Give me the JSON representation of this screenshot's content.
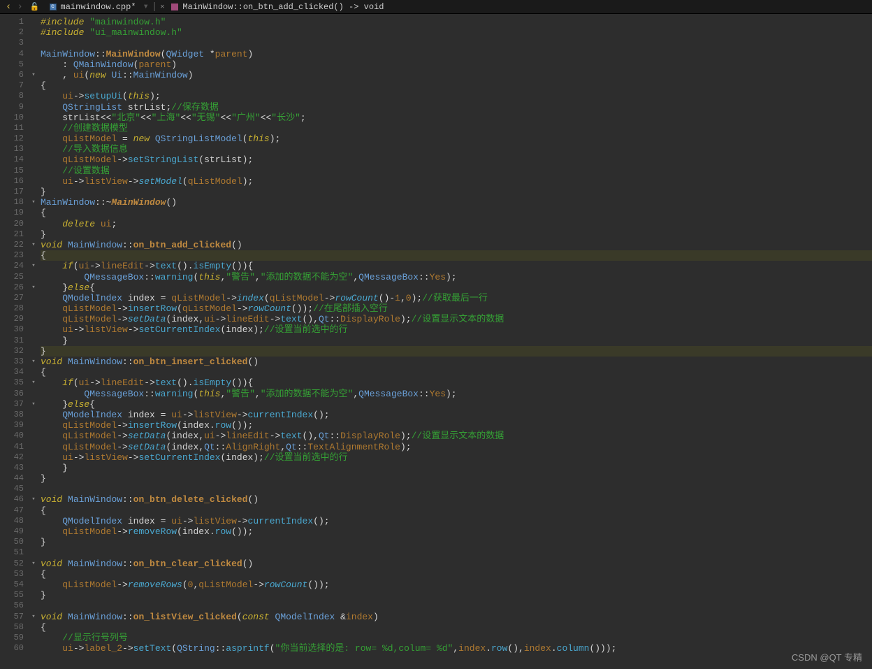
{
  "toolbar": {
    "tab_filename": "mainwindow.cpp*",
    "breadcrumb": "MainWindow::on_btn_add_clicked() -> void"
  },
  "watermark": "CSDN @QT 专精",
  "fold_markers": {
    "6": "▾",
    "18": "▾",
    "22": "▾",
    "24": "▾",
    "26": "▾",
    "33": "▾",
    "35": "▾",
    "37": "▾",
    "46": "▾",
    "52": "▾",
    "57": "▾"
  },
  "code_lines": [
    {
      "n": 1,
      "html": "<span class='kw'>#include</span> <span class='str'>\"mainwindow.h\"</span>"
    },
    {
      "n": 2,
      "html": "<span class='kw'>#include</span> <span class='str'>\"ui_mainwindow.h\"</span>"
    },
    {
      "n": 3,
      "html": ""
    },
    {
      "n": 4,
      "html": "<span class='cls'>MainWindow</span>::<span class='memb'>MainWindow</span>(<span class='typ'>QWidget</span> *<span class='mem'>parent</span>)"
    },
    {
      "n": 5,
      "html": "    : <span class='typ'>QMainWindow</span>(<span class='mem'>parent</span>)"
    },
    {
      "n": 6,
      "html": "    , <span class='mem'>ui</span>(<span class='kw'>new</span> <span class='ns'>Ui</span>::<span class='typ'>MainWindow</span>)"
    },
    {
      "n": 7,
      "html": "{"
    },
    {
      "n": 8,
      "html": "    <span class='mem'>ui</span>-&gt;<span class='fn'>setupUi</span>(<span class='kw'>this</span>);"
    },
    {
      "n": 9,
      "html": "    <span class='typ'>QStringList</span> strList;<span class='cmt'>//保存数据</span>"
    },
    {
      "n": 10,
      "html": "    strList&lt;&lt;<span class='str'>\"北京\"</span>&lt;&lt;<span class='str'>\"上海\"</span>&lt;&lt;<span class='str'>\"无锡\"</span>&lt;&lt;<span class='str'>\"广州\"</span>&lt;&lt;<span class='str'>\"长沙\"</span>;"
    },
    {
      "n": 11,
      "html": "    <span class='cmt'>//创建数据模型</span>"
    },
    {
      "n": 12,
      "html": "    <span class='mem'>qListModel</span> = <span class='kw'>new</span> <span class='typ'>QStringListModel</span>(<span class='kw'>this</span>);"
    },
    {
      "n": 13,
      "html": "    <span class='cmt'>//导入数据信息</span>"
    },
    {
      "n": 14,
      "html": "    <span class='mem'>qListModel</span>-&gt;<span class='fn'>setStringList</span>(strList);"
    },
    {
      "n": 15,
      "html": "    <span class='cmt'>//设置数据</span>"
    },
    {
      "n": 16,
      "html": "    <span class='mem'>ui</span>-&gt;<span class='mem'>listView</span>-&gt;<span class='fni'>setModel</span>(<span class='mem'>qListModel</span>);"
    },
    {
      "n": 17,
      "html": "}"
    },
    {
      "n": 18,
      "html": "<span class='cls'>MainWindow</span>::~<span class='memb emph'>MainWindow</span>()"
    },
    {
      "n": 19,
      "html": "{"
    },
    {
      "n": 20,
      "html": "    <span class='kw'>delete</span> <span class='mem'>ui</span>;"
    },
    {
      "n": 21,
      "html": "}"
    },
    {
      "n": 22,
      "html": "<span class='kw'>void</span> <span class='cls'>MainWindow</span>::<span class='memb'>on_btn_add_clicked</span>()"
    },
    {
      "n": 23,
      "html": "<span class='hl-line'>{</span>"
    },
    {
      "n": 24,
      "html": "    <span class='kw'>if</span>(<span class='mem'>ui</span>-&gt;<span class='mem'>lineEdit</span>-&gt;<span class='fn'>text</span>().<span class='fn'>isEmpty</span>()){"
    },
    {
      "n": 25,
      "html": "        <span class='typ'>QMessageBox</span>::<span class='fn'>warning</span>(<span class='kw'>this</span>,<span class='str'>\"警告\"</span>,<span class='str'>\"添加的数据不能为空\"</span>,<span class='typ'>QMessageBox</span>::<span class='mem'>Yes</span>);"
    },
    {
      "n": 26,
      "html": "    }<span class='kw'>else</span>{"
    },
    {
      "n": 27,
      "html": "    <span class='typ'>QModelIndex</span> index = <span class='mem'>qListModel</span>-&gt;<span class='fni'>index</span>(<span class='mem'>qListModel</span>-&gt;<span class='fni'>rowCount</span>()-<span class='num'>1</span>,<span class='num'>0</span>);<span class='cmt'>//获取最后一行</span>"
    },
    {
      "n": 28,
      "html": "    <span class='mem'>qListModel</span>-&gt;<span class='fn'>insertRow</span>(<span class='mem'>qListModel</span>-&gt;<span class='fni'>rowCount</span>());<span class='cmt'>//在尾部插入空行</span>"
    },
    {
      "n": 29,
      "html": "    <span class='mem'>qListModel</span>-&gt;<span class='fni'>setData</span>(index,<span class='mem'>ui</span>-&gt;<span class='mem'>lineEdit</span>-&gt;<span class='fn'>text</span>(),<span class='ns'>Qt</span>::<span class='mem'>DisplayRole</span>);<span class='cmt'>//设置显示文本的数据</span>"
    },
    {
      "n": 30,
      "html": "    <span class='mem'>ui</span>-&gt;<span class='mem'>listView</span>-&gt;<span class='fn'>setCurrentIndex</span>(index);<span class='cmt'>//设置当前选中的行</span>"
    },
    {
      "n": 31,
      "html": "    }"
    },
    {
      "n": 32,
      "html": "<span class='hl-line'>}</span>"
    },
    {
      "n": 33,
      "html": "<span class='kw'>void</span> <span class='cls'>MainWindow</span>::<span class='memb'>on_btn_insert_clicked</span>()"
    },
    {
      "n": 34,
      "html": "{"
    },
    {
      "n": 35,
      "html": "    <span class='kw'>if</span>(<span class='mem'>ui</span>-&gt;<span class='mem'>lineEdit</span>-&gt;<span class='fn'>text</span>().<span class='fn'>isEmpty</span>()){"
    },
    {
      "n": 36,
      "html": "        <span class='typ'>QMessageBox</span>::<span class='fn'>warning</span>(<span class='kw'>this</span>,<span class='str'>\"警告\"</span>,<span class='str'>\"添加的数据不能为空\"</span>,<span class='typ'>QMessageBox</span>::<span class='mem'>Yes</span>);"
    },
    {
      "n": 37,
      "html": "    }<span class='kw'>else</span>{"
    },
    {
      "n": 38,
      "html": "    <span class='typ'>QModelIndex</span> index = <span class='mem'>ui</span>-&gt;<span class='mem'>listView</span>-&gt;<span class='fn'>currentIndex</span>();"
    },
    {
      "n": 39,
      "html": "    <span class='mem'>qListModel</span>-&gt;<span class='fn'>insertRow</span>(index.<span class='fn'>row</span>());"
    },
    {
      "n": 40,
      "html": "    <span class='mem'>qListModel</span>-&gt;<span class='fni'>setData</span>(index,<span class='mem'>ui</span>-&gt;<span class='mem'>lineEdit</span>-&gt;<span class='fn'>text</span>(),<span class='ns'>Qt</span>::<span class='mem'>DisplayRole</span>);<span class='cmt'>//设置显示文本的数据</span>"
    },
    {
      "n": 41,
      "html": "    <span class='mem'>qListModel</span>-&gt;<span class='fni'>setData</span>(index,<span class='ns'>Qt</span>::<span class='mem'>AlignRight</span>,<span class='ns'>Qt</span>::<span class='mem'>TextAlignmentRole</span>);"
    },
    {
      "n": 42,
      "html": "    <span class='mem'>ui</span>-&gt;<span class='mem'>listView</span>-&gt;<span class='fn'>setCurrentIndex</span>(index);<span class='cmt'>//设置当前选中的行</span>"
    },
    {
      "n": 43,
      "html": "    }"
    },
    {
      "n": 44,
      "html": "}"
    },
    {
      "n": 45,
      "html": ""
    },
    {
      "n": 46,
      "html": "<span class='kw'>void</span> <span class='cls'>MainWindow</span>::<span class='memb'>on_btn_delete_clicked</span>()"
    },
    {
      "n": 47,
      "html": "{"
    },
    {
      "n": 48,
      "html": "    <span class='typ'>QModelIndex</span> index = <span class='mem'>ui</span>-&gt;<span class='mem'>listView</span>-&gt;<span class='fn'>currentIndex</span>();"
    },
    {
      "n": 49,
      "html": "    <span class='mem'>qListModel</span>-&gt;<span class='fn'>removeRow</span>(index.<span class='fn'>row</span>());"
    },
    {
      "n": 50,
      "html": "}"
    },
    {
      "n": 51,
      "html": ""
    },
    {
      "n": 52,
      "html": "<span class='kw'>void</span> <span class='cls'>MainWindow</span>::<span class='memb'>on_btn_clear_clicked</span>()"
    },
    {
      "n": 53,
      "html": "{"
    },
    {
      "n": 54,
      "html": "    <span class='mem'>qListModel</span>-&gt;<span class='fni'>removeRows</span>(<span class='num'>0</span>,<span class='mem'>qListModel</span>-&gt;<span class='fni'>rowCount</span>());"
    },
    {
      "n": 55,
      "html": "}"
    },
    {
      "n": 56,
      "html": ""
    },
    {
      "n": 57,
      "html": "<span class='kw'>void</span> <span class='cls'>MainWindow</span>::<span class='memb'>on_listView_clicked</span>(<span class='kw'>const</span> <span class='typ'>QModelIndex</span> &amp;<span class='mem'>index</span>)"
    },
    {
      "n": 58,
      "html": "{"
    },
    {
      "n": 59,
      "html": "    <span class='cmt'>//显示行号列号</span>"
    },
    {
      "n": 60,
      "html": "    <span class='mem'>ui</span>-&gt;<span class='mem'>label_2</span>-&gt;<span class='fn'>setText</span>(<span class='typ'>QString</span>::<span class='fn'>asprintf</span>(<span class='str'>\"你当前选择的是: row= %d,colum= %d\"</span>,<span class='mem'>index</span>.<span class='fn'>row</span>(),<span class='mem'>index</span>.<span class='fn'>column</span>()));"
    }
  ]
}
